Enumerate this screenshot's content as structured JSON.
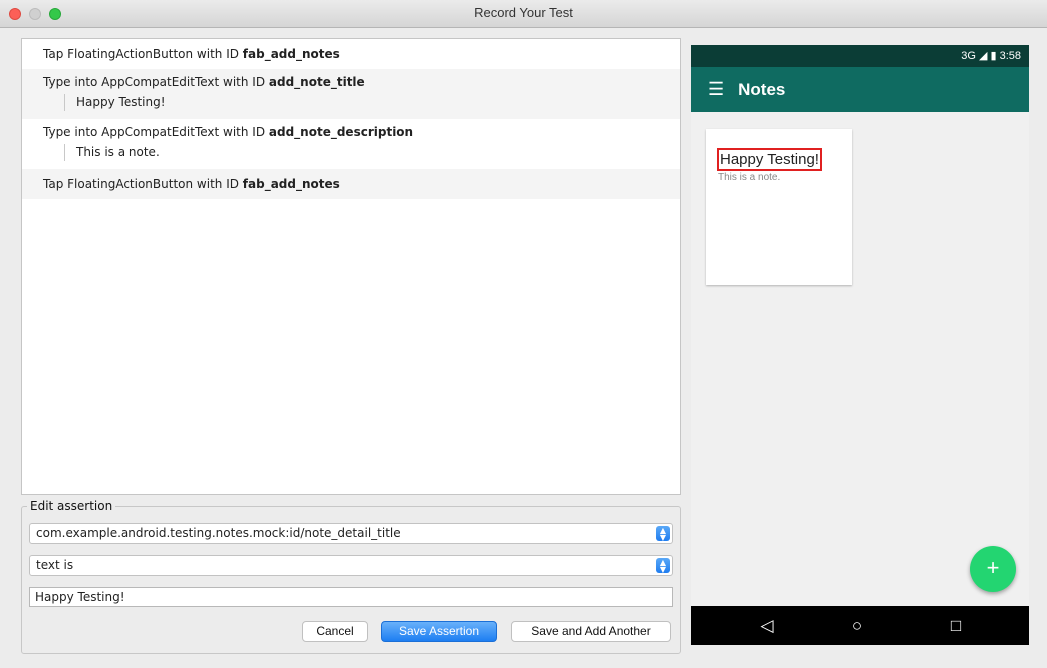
{
  "window": {
    "title": "Record Your Test"
  },
  "steps": [
    {
      "prefix": "Tap FloatingActionButton with ID ",
      "id": "fab_add_notes"
    },
    {
      "prefix": "Type into AppCompatEditText with ID ",
      "id": "add_note_title",
      "value": "Happy Testing!"
    },
    {
      "prefix": "Type into AppCompatEditText with ID ",
      "id": "add_note_description",
      "value": "This is a note."
    },
    {
      "prefix": "Tap FloatingActionButton with ID ",
      "id": "fab_add_notes"
    }
  ],
  "assertion": {
    "legend": "Edit assertion",
    "element_select": "com.example.android.testing.notes.mock:id/note_detail_title",
    "condition_select": "text is",
    "value_input": "Happy Testing!",
    "cancel_label": "Cancel",
    "save_label": "Save Assertion",
    "save_add_label": "Save and Add Another"
  },
  "device": {
    "status_text": "3G ◢ ▮ 3:58",
    "menu_icon": "☰",
    "app_title": "Notes",
    "note_title": "Happy Testing!",
    "note_description": "This is a note.",
    "fab_icon": "+",
    "nav_back": "◁",
    "nav_home": "○",
    "nav_recents": "□"
  },
  "colors": {
    "app_bar": "#0f6b61",
    "status_bar": "#0b3d36",
    "fab": "#23d571",
    "primary_button": "#1d7ef2",
    "highlight": "#e02020"
  }
}
